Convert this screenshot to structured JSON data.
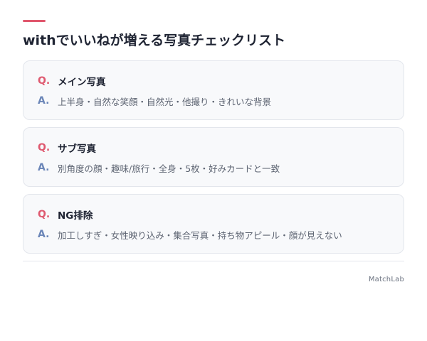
{
  "colors": {
    "accent": "#e0576d",
    "question_mark": "#df5a70",
    "answer_mark": "#6b86b8",
    "card_bg": "#f8f9fb",
    "card_border": "#e3e6ec"
  },
  "header": {
    "title": "withでいいねが増える写真チェックリスト"
  },
  "qa": [
    {
      "q_mark": "Q.",
      "question": "メイン写真",
      "a_mark": "A.",
      "answer": "上半身・自然な笑顔・自然光・他撮り・きれいな背景"
    },
    {
      "q_mark": "Q.",
      "question": "サブ写真",
      "a_mark": "A.",
      "answer": "別角度の顔・趣味/旅行・全身・5枚・好みカードと一致"
    },
    {
      "q_mark": "Q.",
      "question": "NG排除",
      "a_mark": "A.",
      "answer": "加工しすぎ・女性映り込み・集合写真・持ち物アピール・顔が見えない"
    }
  ],
  "footer": {
    "brand": "MatchLab"
  }
}
